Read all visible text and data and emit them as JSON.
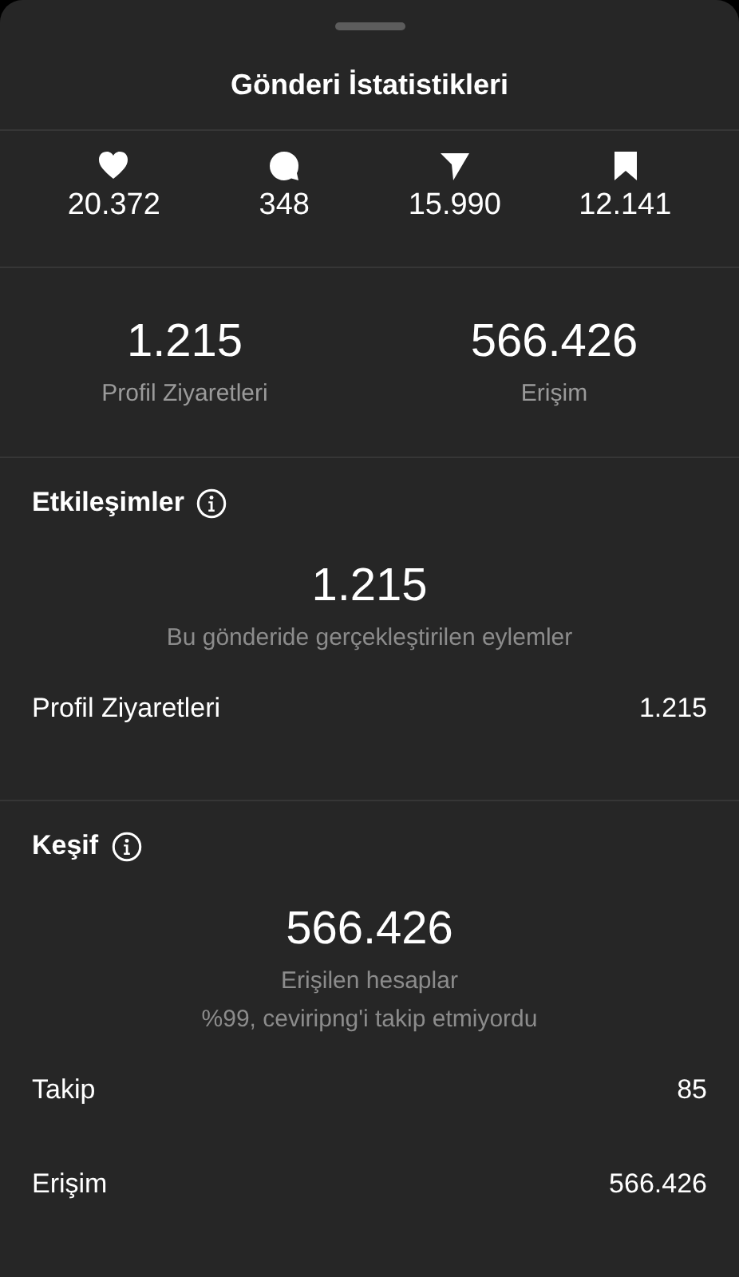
{
  "title": "Gönderi İstatistikleri",
  "stats": [
    {
      "kind": "like",
      "value": "20.372"
    },
    {
      "kind": "comment",
      "value": "348"
    },
    {
      "kind": "share",
      "value": "15.990"
    },
    {
      "kind": "save",
      "value": "12.141"
    }
  ],
  "summary": [
    {
      "value": "1.215",
      "label": "Profil Ziyaretleri"
    },
    {
      "value": "566.426",
      "label": "Erişim"
    }
  ],
  "sections": [
    {
      "title": "Etkileşimler",
      "value": "1.215",
      "captions": [
        "Bu gönderide gerçekleştirilen eylemler"
      ],
      "rows": [
        {
          "label": "Profil Ziyaretleri",
          "value": "1.215"
        }
      ]
    },
    {
      "title": "Keşif",
      "value": "566.426",
      "captions": [
        "Erişilen hesaplar",
        "%99, ceviripng'i takip etmiyordu"
      ],
      "rows": [
        {
          "label": "Takip",
          "value": "85"
        },
        {
          "label": "Erişim",
          "value": "566.426"
        }
      ]
    }
  ]
}
